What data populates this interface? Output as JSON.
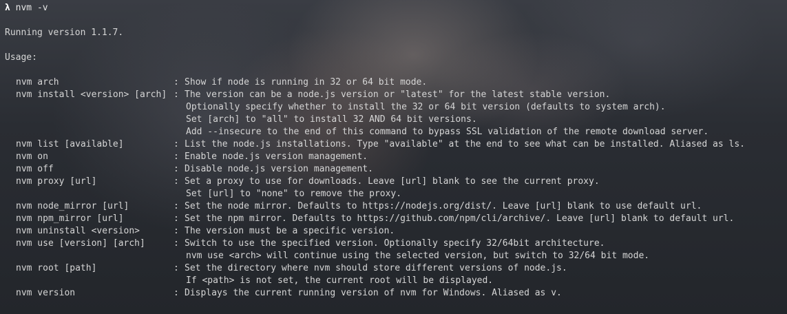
{
  "prompt": {
    "symbol": "λ",
    "command": "nvm -v"
  },
  "version_line": "Running version 1.1.7.",
  "usage_header": "Usage:",
  "separator": ":",
  "commands": [
    {
      "name": "nvm arch",
      "desc": [
        "Show if node is running in 32 or 64 bit mode."
      ]
    },
    {
      "name": "nvm install <version> [arch]",
      "desc": [
        "The version can be a node.js version or \"latest\" for the latest stable version.",
        "Optionally specify whether to install the 32 or 64 bit version (defaults to system arch).",
        "Set [arch] to \"all\" to install 32 AND 64 bit versions.",
        "Add --insecure to the end of this command to bypass SSL validation of the remote download server."
      ]
    },
    {
      "name": "nvm list [available]",
      "desc": [
        "List the node.js installations. Type \"available\" at the end to see what can be installed. Aliased as ls."
      ]
    },
    {
      "name": "nvm on",
      "desc": [
        "Enable node.js version management."
      ]
    },
    {
      "name": "nvm off",
      "desc": [
        "Disable node.js version management."
      ]
    },
    {
      "name": "nvm proxy [url]",
      "desc": [
        "Set a proxy to use for downloads. Leave [url] blank to see the current proxy.",
        "Set [url] to \"none\" to remove the proxy."
      ]
    },
    {
      "name": "nvm node_mirror [url]",
      "desc": [
        "Set the node mirror. Defaults to https://nodejs.org/dist/. Leave [url] blank to use default url."
      ]
    },
    {
      "name": "nvm npm_mirror [url]",
      "desc": [
        "Set the npm mirror. Defaults to https://github.com/npm/cli/archive/. Leave [url] blank to default url."
      ]
    },
    {
      "name": "nvm uninstall <version>",
      "desc": [
        "The version must be a specific version."
      ]
    },
    {
      "name": "nvm use [version] [arch]",
      "desc": [
        "Switch to use the specified version. Optionally specify 32/64bit architecture.",
        "nvm use <arch> will continue using the selected version, but switch to 32/64 bit mode."
      ]
    },
    {
      "name": "nvm root [path]",
      "desc": [
        "Set the directory where nvm should store different versions of node.js.",
        "If <path> is not set, the current root will be displayed."
      ]
    },
    {
      "name": "nvm version",
      "desc": [
        "Displays the current running version of nvm for Windows. Aliased as v."
      ]
    }
  ]
}
